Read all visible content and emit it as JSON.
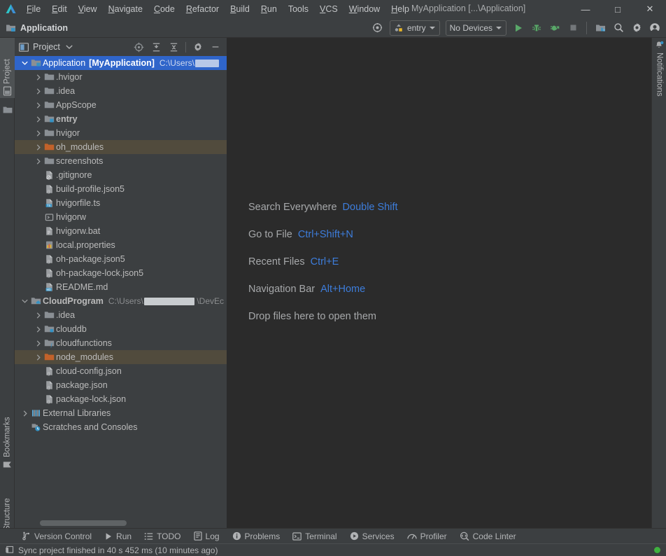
{
  "app": {
    "logo_icon": "deveco-studio-logo-icon",
    "window_title": "MyApplication [...\\Application]",
    "breadcrumb_title": "Application"
  },
  "menubar": {
    "items": [
      {
        "label": "File",
        "mnemonic": "F"
      },
      {
        "label": "Edit",
        "mnemonic": "E"
      },
      {
        "label": "View",
        "mnemonic": "V"
      },
      {
        "label": "Navigate",
        "mnemonic": "N"
      },
      {
        "label": "Code",
        "mnemonic": "C"
      },
      {
        "label": "Refactor",
        "mnemonic": "R"
      },
      {
        "label": "Build",
        "mnemonic": "B"
      },
      {
        "label": "Run",
        "mnemonic": "R"
      },
      {
        "label": "Tools",
        "mnemonic": "T"
      },
      {
        "label": "VCS",
        "mnemonic": "V"
      },
      {
        "label": "Window",
        "mnemonic": "W"
      },
      {
        "label": "Help",
        "mnemonic": "H"
      }
    ]
  },
  "window_controls": {
    "minimize": "—",
    "maximize": "□",
    "close": "✕"
  },
  "toolbar": {
    "project_label": "Application",
    "project_icon": "module-folder-icon",
    "settings_icon": "project-structure-icon",
    "run_config": {
      "label": "entry",
      "icon": "module-entry-icon"
    },
    "device_select": {
      "label": "No Devices"
    },
    "run_button": "run-icon",
    "debug_button": "debug-icon",
    "attach_debugger_button": "attach-debugger-icon",
    "stop_button": "stop-icon",
    "device_manager_button": "device-manager-icon",
    "search_button": "search-icon",
    "settings_button": "gear-icon",
    "account_button": "account-avatar-icon"
  },
  "left_strip": {
    "tabs": [
      {
        "label": "Project",
        "icon": "project-panel-icon",
        "active": true
      },
      {
        "label": "Bookmarks",
        "icon": "bookmarks-icon",
        "active": false
      },
      {
        "label": "Structure",
        "icon": "structure-icon",
        "active": false
      }
    ]
  },
  "right_strip": {
    "tabs": [
      {
        "label": "Notifications",
        "icon": "notifications-bell-icon",
        "active": false
      }
    ]
  },
  "project_panel": {
    "title": "Project",
    "view_icon": "project-view-icon",
    "dropdown_icon": "chevron-down-icon",
    "actions": [
      {
        "name": "select-opened-file-icon",
        "title": "Select Opened File"
      },
      {
        "name": "expand-all-icon",
        "title": "Expand All"
      },
      {
        "name": "collapse-all-icon",
        "title": "Collapse All"
      },
      {
        "name": "gear-icon",
        "title": "Options"
      },
      {
        "name": "hide-icon",
        "title": "Hide"
      }
    ],
    "tree": [
      {
        "indent": 0,
        "arrow": "down",
        "icon": "module-folder-icon",
        "label": "Application",
        "bold_suffix": "[MyApplication]",
        "path": "C:\\Users\\",
        "redacted": true,
        "state": "selected"
      },
      {
        "indent": 1,
        "arrow": "right",
        "icon": "folder-icon",
        "label": ".hvigor",
        "state": "normal"
      },
      {
        "indent": 1,
        "arrow": "right",
        "icon": "folder-icon",
        "label": ".idea",
        "state": "normal"
      },
      {
        "indent": 1,
        "arrow": "right",
        "icon": "folder-icon",
        "label": "AppScope",
        "state": "normal"
      },
      {
        "indent": 1,
        "arrow": "right",
        "icon": "module-folder-icon",
        "label": "entry",
        "bold": true,
        "state": "normal"
      },
      {
        "indent": 1,
        "arrow": "right",
        "icon": "folder-icon",
        "label": "hvigor",
        "state": "normal"
      },
      {
        "indent": 1,
        "arrow": "right",
        "icon": "excluded-folder-icon",
        "label": "oh_modules",
        "state": "highlight"
      },
      {
        "indent": 1,
        "arrow": "right",
        "icon": "folder-icon",
        "label": "screenshots",
        "state": "normal"
      },
      {
        "indent": 1,
        "arrow": "none",
        "icon": "gitignore-file-icon",
        "label": ".gitignore",
        "state": "normal"
      },
      {
        "indent": 1,
        "arrow": "none",
        "icon": "json5-file-icon",
        "label": "build-profile.json5",
        "state": "normal"
      },
      {
        "indent": 1,
        "arrow": "none",
        "icon": "typescript-file-icon",
        "label": "hvigorfile.ts",
        "state": "normal"
      },
      {
        "indent": 1,
        "arrow": "none",
        "icon": "shell-script-icon",
        "label": "hvigorw",
        "state": "normal"
      },
      {
        "indent": 1,
        "arrow": "none",
        "icon": "bat-file-icon",
        "label": "hvigorw.bat",
        "state": "normal"
      },
      {
        "indent": 1,
        "arrow": "none",
        "icon": "properties-file-icon",
        "label": "local.properties",
        "state": "normal"
      },
      {
        "indent": 1,
        "arrow": "none",
        "icon": "json5-file-icon",
        "label": "oh-package.json5",
        "state": "normal"
      },
      {
        "indent": 1,
        "arrow": "none",
        "icon": "json5-file-icon",
        "label": "oh-package-lock.json5",
        "state": "normal"
      },
      {
        "indent": 1,
        "arrow": "none",
        "icon": "markdown-file-icon",
        "label": "README.md",
        "state": "normal"
      },
      {
        "indent": 0,
        "arrow": "down",
        "icon": "cloud-module-icon",
        "label": "CloudProgram",
        "bold": true,
        "path": "C:\\Users\\",
        "path_suffix": "\\DevEc",
        "redacted": true,
        "state": "normal"
      },
      {
        "indent": 1,
        "arrow": "right",
        "icon": "folder-icon",
        "label": ".idea",
        "state": "normal"
      },
      {
        "indent": 1,
        "arrow": "right",
        "icon": "clouddb-folder-icon",
        "label": "clouddb",
        "state": "normal"
      },
      {
        "indent": 1,
        "arrow": "right",
        "icon": "cloudfunctions-folder-icon",
        "label": "cloudfunctions",
        "state": "normal"
      },
      {
        "indent": 1,
        "arrow": "right",
        "icon": "excluded-folder-icon",
        "label": "node_modules",
        "state": "highlight"
      },
      {
        "indent": 1,
        "arrow": "none",
        "icon": "json-file-icon",
        "label": "cloud-config.json",
        "state": "normal"
      },
      {
        "indent": 1,
        "arrow": "none",
        "icon": "json-file-icon",
        "label": "package.json",
        "state": "normal"
      },
      {
        "indent": 1,
        "arrow": "none",
        "icon": "json-file-icon",
        "label": "package-lock.json",
        "state": "normal"
      },
      {
        "indent": 0,
        "arrow": "right",
        "icon": "external-libraries-icon",
        "label": "External Libraries",
        "state": "normal"
      },
      {
        "indent": 0,
        "arrow": "none",
        "icon": "scratches-icon",
        "label": "Scratches and Consoles",
        "state": "normal"
      }
    ]
  },
  "editor": {
    "hints": [
      {
        "label": "Search Everywhere",
        "shortcut": "Double Shift"
      },
      {
        "label": "Go to File",
        "shortcut": "Ctrl+Shift+N"
      },
      {
        "label": "Recent Files",
        "shortcut": "Ctrl+E"
      },
      {
        "label": "Navigation Bar",
        "shortcut": "Alt+Home"
      },
      {
        "label": "Drop files here to open them",
        "shortcut": ""
      }
    ]
  },
  "bottom_bar": {
    "items": [
      {
        "label": "Version Control",
        "icon": "branch-icon"
      },
      {
        "label": "Run",
        "icon": "run-icon"
      },
      {
        "label": "TODO",
        "icon": "todo-list-icon"
      },
      {
        "label": "Log",
        "icon": "log-icon"
      },
      {
        "label": "Problems",
        "icon": "problems-icon"
      },
      {
        "label": "Terminal",
        "icon": "terminal-icon"
      },
      {
        "label": "Services",
        "icon": "services-icon"
      },
      {
        "label": "Profiler",
        "icon": "profiler-icon"
      },
      {
        "label": "Code Linter",
        "icon": "code-linter-icon"
      }
    ]
  },
  "status_bar": {
    "icon": "event-log-icon",
    "message": "Sync project finished in 40 s 452 ms (10 minutes ago)",
    "indicator": "ready-green-dot"
  },
  "colors": {
    "window_bg": "#3c3f41",
    "editor_bg": "#2b2b2b",
    "selection_blue": "#2f65ca",
    "excluded_highlight": "#514b3d",
    "accent_link": "#3d7ddb",
    "text_primary": "#bbbbbb",
    "text_muted": "#8b8d8f",
    "run_green": "#5ba85b",
    "folder_orange": "#c2622a",
    "status_green": "#3fb13f"
  }
}
